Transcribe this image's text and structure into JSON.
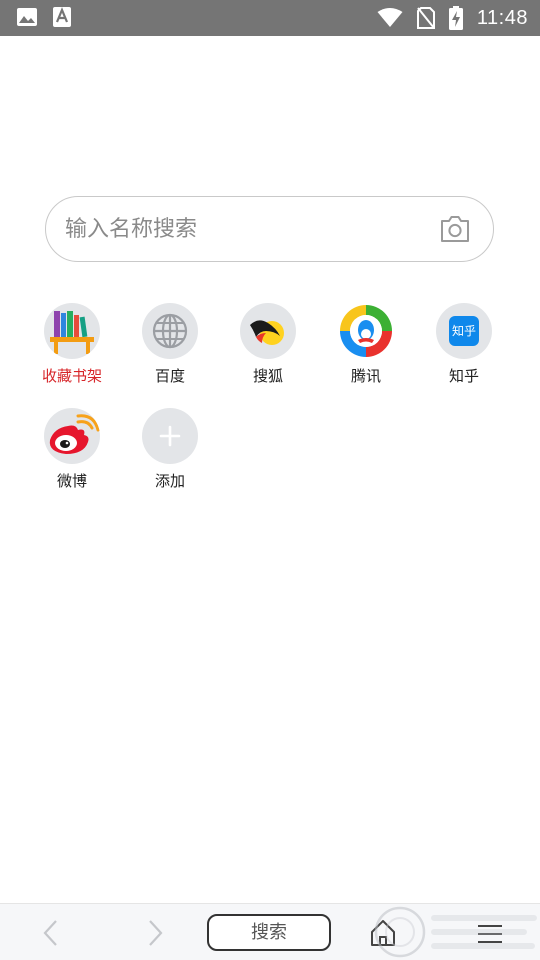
{
  "status_bar": {
    "time": "11:48",
    "icons": [
      "image-notification-icon",
      "font-notification-icon",
      "wifi-icon",
      "no-sim-icon",
      "battery-charging-icon"
    ]
  },
  "search": {
    "placeholder": "输入名称搜索",
    "camera_icon": "camera-icon"
  },
  "sites": [
    {
      "label": "收藏书架",
      "icon": "bookshelf-icon",
      "highlight": true
    },
    {
      "label": "百度",
      "icon": "globe-icon"
    },
    {
      "label": "搜狐",
      "icon": "sohu-fox-icon"
    },
    {
      "label": "腾讯",
      "icon": "tencent-penguin-icon"
    },
    {
      "label": "知乎",
      "icon": "zhihu-icon",
      "badge": "知乎"
    },
    {
      "label": "微博",
      "icon": "weibo-icon"
    },
    {
      "label": "添加",
      "icon": "plus-icon"
    }
  ],
  "bottom_bar": {
    "back_icon": "back-arrow-icon",
    "forward_icon": "forward-arrow-icon",
    "search_label": "搜索",
    "home_icon": "home-icon",
    "menu_icon": "menu-icon"
  },
  "colors": {
    "status_bar": "#757575",
    "highlight_label": "#d7262a",
    "icon_circle": "#e3e5e8",
    "zhihu_blue": "#0f88eb",
    "weibo_red": "#e6162d"
  }
}
